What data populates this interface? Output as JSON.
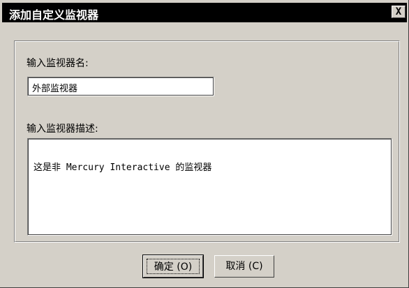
{
  "window": {
    "title": "添加自定义监视器",
    "close_glyph": "X"
  },
  "form": {
    "name_label": "输入监视器名:",
    "name_value": "外部监视器",
    "desc_label": "输入监视器描述:",
    "desc_value": "这是非 Mercury Interactive 的监视器"
  },
  "buttons": {
    "ok_label": "确定 (O)",
    "cancel_label": "取消 (C)"
  },
  "colors": {
    "titlebar": "#000000",
    "dialog_bg": "#d4d0c8",
    "field_bg": "#ffffff"
  },
  "icons": {
    "close": "close-icon"
  }
}
